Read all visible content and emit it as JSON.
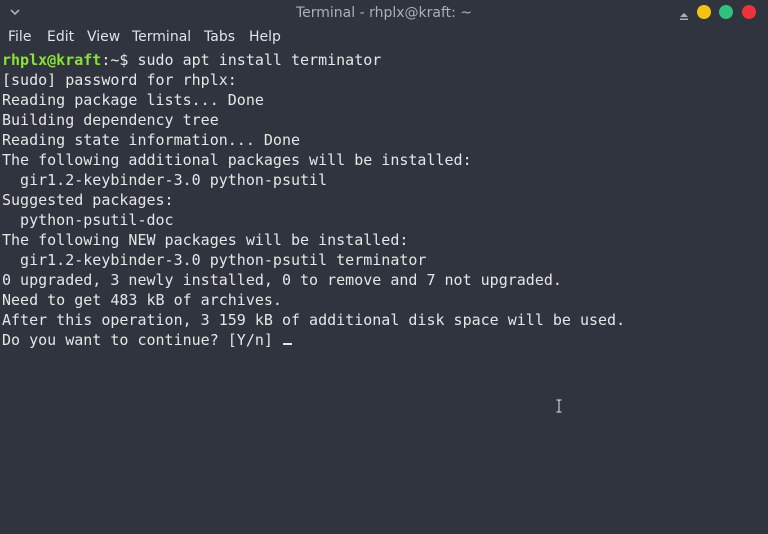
{
  "window": {
    "title": "Terminal - rhplx@kraft: ~"
  },
  "menubar": {
    "items": [
      "File",
      "Edit",
      "View",
      "Terminal",
      "Tabs",
      "Help"
    ]
  },
  "terminal": {
    "prompt_user": "rhplx@kraft",
    "prompt_path": ":~$ ",
    "command": "sudo apt install terminator",
    "output": [
      "[sudo] password for rhplx:",
      "Reading package lists... Done",
      "Building dependency tree",
      "Reading state information... Done",
      "The following additional packages will be installed:",
      "  gir1.2-keybinder-3.0 python-psutil",
      "Suggested packages:",
      "  python-psutil-doc",
      "The following NEW packages will be installed:",
      "  gir1.2-keybinder-3.0 python-psutil terminator",
      "0 upgraded, 3 newly installed, 0 to remove and 7 not upgraded.",
      "Need to get 483 kB of archives.",
      "After this operation, 3 159 kB of additional disk space will be used.",
      "Do you want to continue? [Y/n] "
    ]
  },
  "colors": {
    "background": "#2f343f",
    "prompt_user": "#8ae234",
    "text": "#e6e6e6",
    "minimize": "#f5c211",
    "maximize": "#2ec27e",
    "close": "#ed333b"
  },
  "icons": {
    "window_menu": "chevron-down-icon",
    "shade": "shade-icon",
    "pointer": "text-cursor-icon"
  }
}
